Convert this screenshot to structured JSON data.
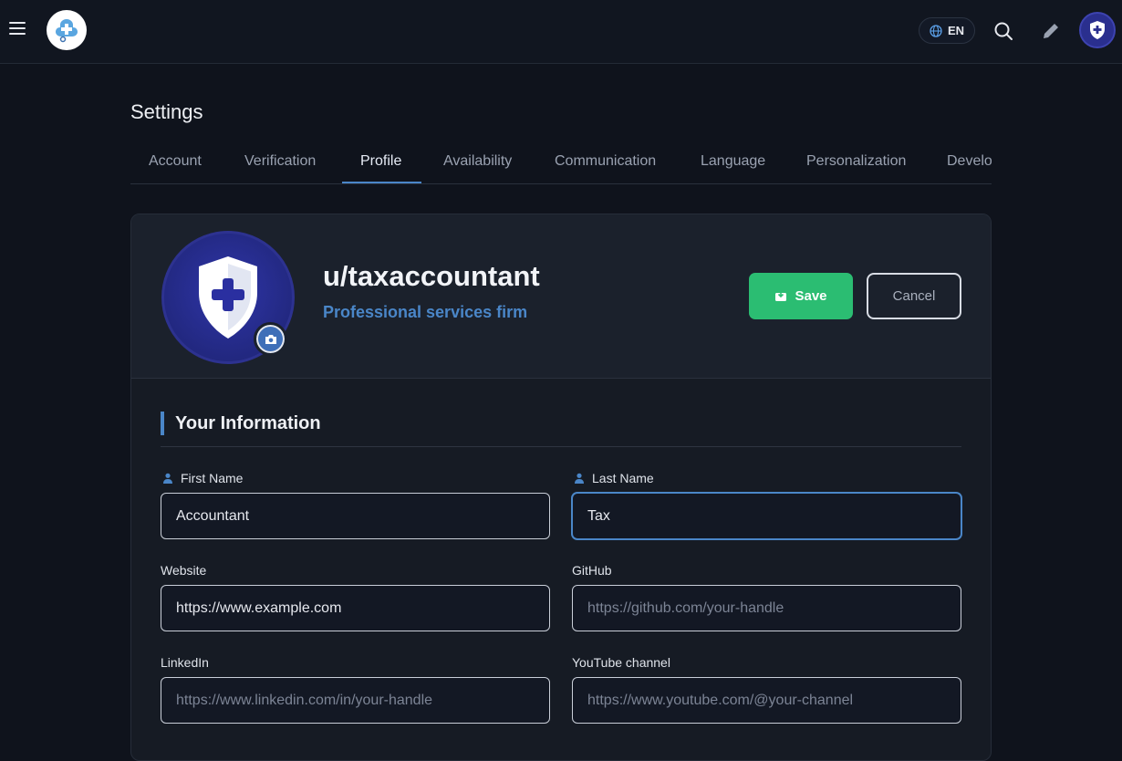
{
  "header": {
    "language": "EN"
  },
  "page": {
    "title": "Settings",
    "tabs": [
      "Account",
      "Verification",
      "Profile",
      "Availability",
      "Communication",
      "Language",
      "Personalization",
      "Develo"
    ],
    "active_tab": "Profile"
  },
  "profile": {
    "username": "u/taxaccountant",
    "subtitle": "Professional services firm",
    "save_label": "Save",
    "cancel_label": "Cancel"
  },
  "form": {
    "section_title": "Your Information",
    "first_name": {
      "label": "First Name",
      "value": "Accountant"
    },
    "last_name": {
      "label": "Last Name",
      "value": "Tax"
    },
    "website": {
      "label": "Website",
      "value": "https://www.example.com"
    },
    "github": {
      "label": "GitHub",
      "placeholder": "https://github.com/your-handle"
    },
    "linkedin": {
      "label": "LinkedIn",
      "placeholder": "https://www.linkedin.com/in/your-handle"
    },
    "youtube": {
      "label": "YouTube channel",
      "placeholder": "https://www.youtube.com/@your-channel"
    }
  },
  "colors": {
    "accent": "#4a86c8",
    "save": "#2bbd72",
    "background": "#0f131c"
  },
  "icons": [
    "menu-icon",
    "logo-icon",
    "globe-icon",
    "search-icon",
    "edit-icon",
    "shield-icon",
    "camera-icon",
    "save-icon",
    "person-icon"
  ]
}
